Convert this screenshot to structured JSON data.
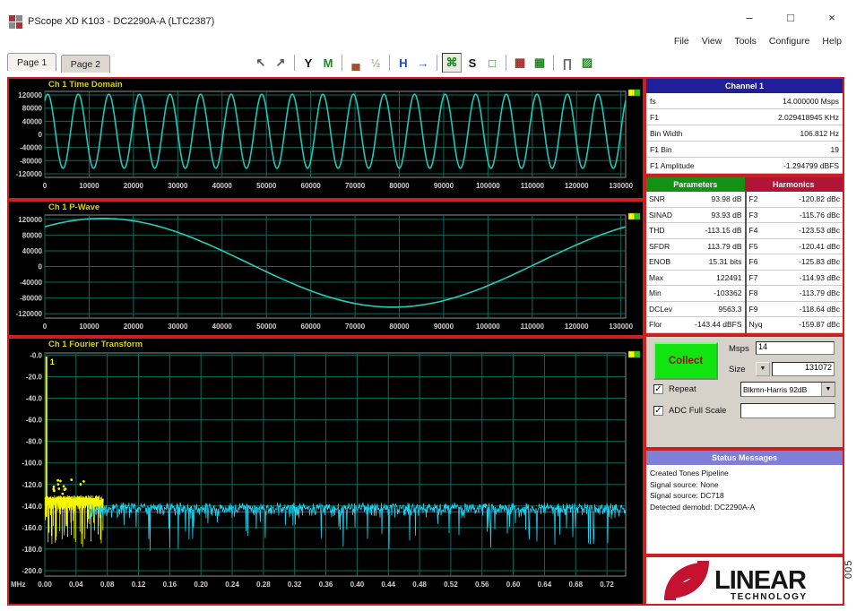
{
  "window": {
    "title": "PScope XD K103 - DC2290A-A (LTC2387)",
    "controls": {
      "minimize": "–",
      "maximize": "□",
      "close": "×"
    }
  },
  "menu": {
    "items": [
      "File",
      "View",
      "Tools",
      "Configure",
      "Help"
    ]
  },
  "tabs": [
    {
      "label": "Page 1",
      "active": true
    },
    {
      "label": "Page 2",
      "active": false
    }
  ],
  "toolbar": {
    "groups": [
      [
        {
          "name": "zoom-cursor-icon",
          "glyph": "↖",
          "color": "#555555"
        },
        {
          "name": "zoom-arrow-icon",
          "glyph": "↗",
          "color": "#555555"
        }
      ],
      [
        {
          "name": "y-scale-icon",
          "glyph": "Y",
          "color": "#111111"
        },
        {
          "name": "measure-icon",
          "glyph": "M",
          "color": "#1b8a1b"
        }
      ],
      [
        {
          "name": "histogram-icon",
          "glyph": "▄",
          "color": "#a0522d"
        },
        {
          "name": "half-scale-icon",
          "glyph": "½",
          "color": "#b4b0a8",
          "disabled": true
        }
      ],
      [
        {
          "name": "averaging-icon",
          "glyph": "H",
          "color": "#2244cc"
        },
        {
          "name": "continuous-collect-icon",
          "glyph": "→",
          "color": "#2244cc"
        }
      ],
      [
        {
          "name": "signal-chain-icon",
          "glyph": "⌘",
          "color": "#1b8a1b",
          "pressed": true
        },
        {
          "name": "tone-icon",
          "glyph": "S",
          "color": "#111111"
        },
        {
          "name": "window-shape-icon",
          "glyph": "□",
          "color": "#1b8a1b"
        }
      ],
      [
        {
          "name": "compare-red-icon",
          "glyph": "▦",
          "color": "#aa2222"
        },
        {
          "name": "compare-green-icon",
          "glyph": "▦",
          "color": "#1b8a1b"
        }
      ],
      [
        {
          "name": "pulse-icon",
          "glyph": "∏",
          "color": "#666666"
        },
        {
          "name": "export-image-icon",
          "glyph": "▨",
          "color": "#1b8a1b"
        }
      ]
    ]
  },
  "channel_panel": {
    "title": "Channel 1",
    "rows": [
      {
        "label": "fs",
        "value": "14.000000 Msps"
      },
      {
        "label": "F1",
        "value": "2.029418945 KHz"
      },
      {
        "label": "Bin Width",
        "value": "106.812 Hz"
      },
      {
        "label": "F1 Bin",
        "value": "19"
      },
      {
        "label": "F1 Amplitude",
        "value": "-1.294799 dBFS"
      }
    ]
  },
  "parameters": {
    "title": "Parameters",
    "rows": [
      {
        "label": "SNR",
        "value": "93.98 dB"
      },
      {
        "label": "SINAD",
        "value": "93.93 dB"
      },
      {
        "label": "THD",
        "value": "-113.15 dB"
      },
      {
        "label": "SFDR",
        "value": "113.79 dB"
      },
      {
        "label": "ENOB",
        "value": "15.31 bits"
      },
      {
        "label": "Max",
        "value": "122491"
      },
      {
        "label": "Min",
        "value": "-103362"
      },
      {
        "label": "DCLev",
        "value": "9563.3"
      },
      {
        "label": "Flor",
        "value": "-143.44 dBFS"
      }
    ]
  },
  "harmonics": {
    "title": "Harmonics",
    "rows": [
      {
        "label": "F2",
        "value": "-120.82 dBc"
      },
      {
        "label": "F3",
        "value": "-115.76 dBc"
      },
      {
        "label": "F4",
        "value": "-123.53 dBc"
      },
      {
        "label": "F5",
        "value": "-120.41 dBc"
      },
      {
        "label": "F6",
        "value": "-125.83 dBc"
      },
      {
        "label": "F7",
        "value": "-114.93 dBc"
      },
      {
        "label": "F8",
        "value": "-113.79 dBc"
      },
      {
        "label": "F9",
        "value": "-118.64 dBc"
      },
      {
        "label": "Nyq",
        "value": "-159.87 dBc"
      }
    ]
  },
  "collect": {
    "button_label": "Collect",
    "msps_label": "Msps",
    "msps_value": "14",
    "size_label": "Size",
    "size_value": "131072",
    "repeat_label": "Repeat",
    "repeat_checked": "✓",
    "window_value": "Blkmn-Harris 92dB",
    "adc_label": "ADC Full Scale",
    "adc_checked": "✓",
    "adc_value": "",
    "dropdown_arrow": "▼"
  },
  "status": {
    "title": "Status Messages",
    "lines": [
      "Created Tones Pipeline",
      "Signal source: None",
      "Signal source: DC718",
      "Detected demobd: DC2290A-A"
    ]
  },
  "logo": {
    "line1": "LINEAR",
    "line2": "TECHNOLOGY"
  },
  "figure_number": "005",
  "chart_data": [
    {
      "type": "line",
      "title": "Ch 1 Time Domain",
      "xlim": [
        0,
        131072
      ],
      "x_ticks": [
        0,
        10000,
        20000,
        30000,
        40000,
        50000,
        60000,
        70000,
        80000,
        90000,
        100000,
        110000,
        120000,
        130000
      ],
      "x_tick_labels": [
        "0",
        "10000",
        "20000",
        "30000",
        "40000",
        "50000",
        "60000",
        "70000",
        "80000",
        "90000",
        "100000",
        "110000",
        "120000",
        "130000"
      ],
      "ylim": [
        -131072,
        131072
      ],
      "y_ticks": [
        120000,
        80000,
        40000,
        0,
        -40000,
        -80000,
        -120000
      ],
      "y_tick_labels": [
        "120000",
        "80000",
        "40000",
        "0",
        "-40000",
        "-80000",
        "-120000"
      ],
      "grid": true,
      "legend_marker": true,
      "series": [
        {
          "name": "ch1-time",
          "type": "sine",
          "color": "#1fc7b7",
          "cycles": 19,
          "amplitude": 112900,
          "offset": 9563,
          "peak_x": 655
        }
      ]
    },
    {
      "type": "line",
      "title": "Ch 1 P-Wave",
      "xlim": [
        0,
        131072
      ],
      "x_ticks": [
        0,
        10000,
        20000,
        30000,
        40000,
        50000,
        60000,
        70000,
        80000,
        90000,
        100000,
        110000,
        120000,
        130000
      ],
      "x_tick_labels": [
        "0",
        "10000",
        "20000",
        "30000",
        "40000",
        "50000",
        "60000",
        "70000",
        "80000",
        "90000",
        "100000",
        "110000",
        "120000",
        "130000"
      ],
      "ylim": [
        -131072,
        131072
      ],
      "y_ticks": [
        120000,
        80000,
        40000,
        0,
        -40000,
        -80000,
        -120000
      ],
      "y_tick_labels": [
        "120000",
        "80000",
        "40000",
        "0",
        "-40000",
        "-80000",
        "-120000"
      ],
      "grid": true,
      "legend_marker": true,
      "series": [
        {
          "name": "ch1-pwave",
          "type": "sine",
          "color": "#27cdbd",
          "cycles": 1,
          "amplitude": 112900,
          "offset": 9563,
          "peak_x": 13000
        }
      ]
    },
    {
      "type": "line",
      "title": "Ch 1 Fourier Transform",
      "x_axis_unit": "MHz",
      "xlim": [
        0,
        0.744
      ],
      "x_ticks": [
        0,
        0.04,
        0.08,
        0.12,
        0.16,
        0.2,
        0.24,
        0.28,
        0.32,
        0.36,
        0.4,
        0.44,
        0.48,
        0.52,
        0.56,
        0.6,
        0.64,
        0.68,
        0.72
      ],
      "x_tick_labels": [
        "0.00",
        "0.04",
        "0.08",
        "0.12",
        "0.16",
        "0.20",
        "0.24",
        "0.28",
        "0.32",
        "0.36",
        "0.40",
        "0.44",
        "0.48",
        "0.52",
        "0.56",
        "0.60",
        "0.64",
        "0.68",
        "0.72"
      ],
      "ylim": [
        -205,
        2
      ],
      "y_ticks": [
        0,
        -20,
        -40,
        -60,
        -80,
        -100,
        -120,
        -140,
        -160,
        -180,
        -200
      ],
      "y_tick_labels": [
        "-0.0",
        "-20.0",
        "-40.0",
        "-60.0",
        "-80.0",
        "-100.0",
        "-120.0",
        "-140.0",
        "-160.0",
        "-180.0",
        "-200.0"
      ],
      "grid": true,
      "legend_marker": true,
      "noise_floor_line": {
        "value": -145.5,
        "color": "#b515b5"
      },
      "fundamental": {
        "freq_mhz": 0.002,
        "amplitude_dbfs": -1.29,
        "marker_label": "1",
        "color": "#f8f800"
      },
      "series": [
        {
          "name": "fft-low-freq-noise",
          "type": "noise",
          "color": "#f8f800",
          "x_range": [
            0.0005,
            0.075
          ],
          "base": -136,
          "seed": 7
        },
        {
          "name": "fft-noise",
          "type": "noise",
          "color": "#19d3f0",
          "x_range": [
            0.055,
            0.744
          ],
          "base": -142.5,
          "seed": 13
        }
      ],
      "scatter": {
        "name": "harmonic-dots",
        "color": "#f8f800",
        "x_range": [
          0.004,
          0.05
        ],
        "y_range": [
          -130,
          -114
        ],
        "count": 14,
        "seed": 5
      }
    }
  ]
}
